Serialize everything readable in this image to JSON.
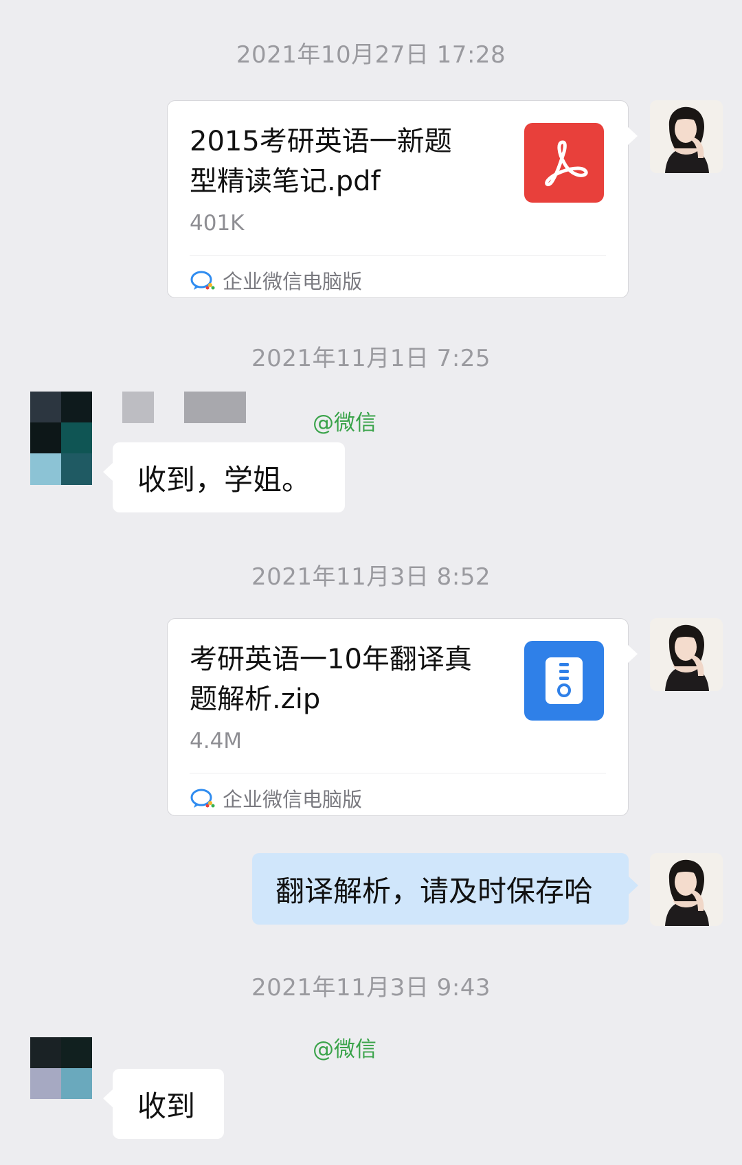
{
  "messages": {
    "ts1": "2021年10月27日  17:28",
    "file1": {
      "name": "2015考研英语一新题型精读笔记.pdf",
      "size": "401K",
      "source": "企业微信电脑版",
      "icon": "pdf-icon",
      "icon_color": "#e8403b"
    },
    "ts2": "2021年11月1日  7:25",
    "tag1": "@微信",
    "reply1": "收到，学姐。",
    "ts3": "2021年11月3日  8:52",
    "file2": {
      "name": "考研英语一10年翻译真题解析.zip",
      "size": "4.4M",
      "source": "企业微信电脑版",
      "icon": "zip-icon",
      "icon_color": "#2f80e8"
    },
    "sent_text": "翻译解析，请及时保存哈",
    "ts4": "2021年11月3日  9:43",
    "tag2": "@微信",
    "reply2": "收到"
  },
  "colors": {
    "background": "#ededf0",
    "sent_bubble": "#d0e6fb",
    "wechat_tag": "#3aa34a"
  }
}
